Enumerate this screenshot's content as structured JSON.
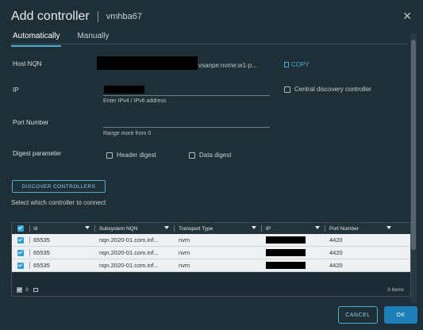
{
  "dialog": {
    "title": "Add controller",
    "subtitle": "vmhba67",
    "close_icon": "close-icon"
  },
  "tabs": [
    {
      "label": "Automatically",
      "active": true
    },
    {
      "label": "Manually",
      "active": false
    }
  ],
  "form": {
    "host_nqn_label": "Host NQN",
    "host_nqn_value": "vsanpe:nvme:w1-p...",
    "copy_label": "COPY",
    "ip_label": "IP",
    "ip_hint": "Enter IPv4 / IPv6 address",
    "central_discovery_label": "Central discovery controller",
    "port_label": "Port Number",
    "port_hint": "Range more from 0",
    "digest_label": "Digest parameter",
    "header_digest_label": "Header digest",
    "data_digest_label": "Data digest"
  },
  "discover_button": "DISCOVER CONTROLLERS",
  "select_text": "Select which controller to connect",
  "grid": {
    "columns": [
      "Id",
      "Subsystem NQN",
      "Transport Type",
      "IP",
      "Port Number"
    ],
    "rows": [
      {
        "id": "65535",
        "nqn": "nqn.2020-01.com.inf...",
        "transport": "nvm",
        "port": "4420",
        "checked": true
      },
      {
        "id": "65535",
        "nqn": "nqn.2020-01.com.inf...",
        "transport": "nvm",
        "port": "4420",
        "checked": true
      },
      {
        "id": "65535",
        "nqn": "nqn.2020-01.com.inf...",
        "transport": "nvm",
        "port": "4420",
        "checked": true
      }
    ],
    "footer_selected": "3",
    "footer_items": "3 items"
  },
  "buttons": {
    "cancel": "CANCEL",
    "ok": "OK"
  },
  "colors": {
    "accent": "#49afd9",
    "primary_button": "#1c7fb8",
    "background": "#1f2f38"
  }
}
